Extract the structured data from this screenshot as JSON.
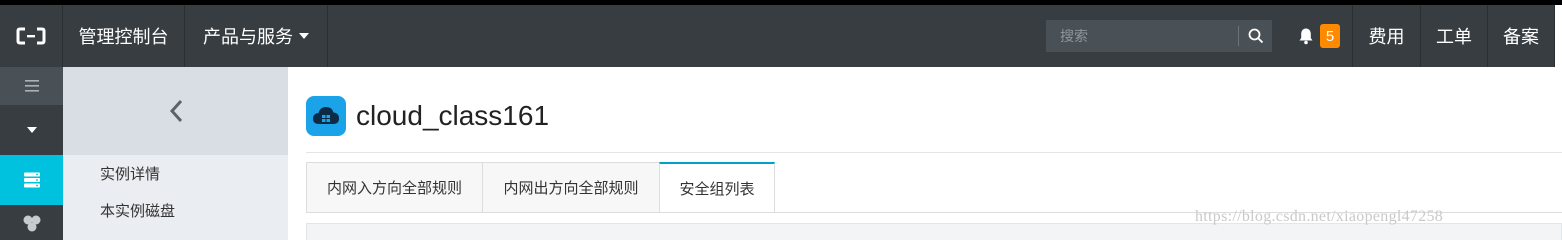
{
  "topbar": {
    "console_label": "管理控制台",
    "products_label": "产品与服务",
    "search_placeholder": "搜索",
    "notification_count": "5",
    "links": [
      "费用",
      "工单",
      "备案"
    ]
  },
  "sidebar": {
    "links": [
      "实例详情",
      "本实例磁盘"
    ]
  },
  "instance": {
    "name": "cloud_class161"
  },
  "tabs": [
    "内网入方向全部规则",
    "内网出方向全部规则",
    "安全组列表"
  ],
  "watermark": "https://blog.csdn.net/xiaopengl47258",
  "colors": {
    "topbar_bg": "#373d41",
    "accent": "#00c1de",
    "badge": "#ff8a00",
    "tab_active_border": "#00a2ca"
  },
  "icons": [
    "aliyun-logo-icon",
    "caret-down-icon",
    "search-icon",
    "bell-icon",
    "menu-icon",
    "collapse-caret-icon",
    "server-list-icon",
    "cluster-icon",
    "chevron-left-icon",
    "cloud-instance-icon"
  ]
}
